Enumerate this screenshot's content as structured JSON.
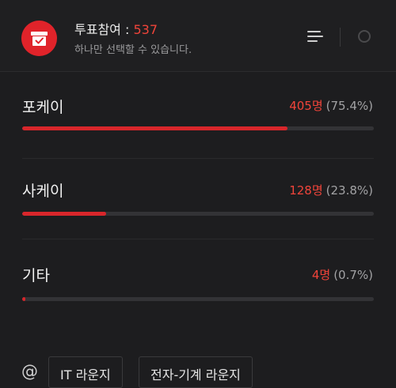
{
  "header": {
    "title_prefix": "투표참여 : ",
    "vote_count": "537",
    "subtitle": "하나만 선택할 수 있습니다."
  },
  "options": [
    {
      "label": "포케이",
      "votes": "405명",
      "percent": "(75.4%)",
      "share": 0.754
    },
    {
      "label": "사케이",
      "votes": "128명",
      "percent": "(23.8%)",
      "share": 0.238
    },
    {
      "label": "기타",
      "votes": "4명",
      "percent": "(0.7%)",
      "share": 0.007
    }
  ],
  "tags": {
    "at_symbol": "@",
    "items": [
      "IT 라운지",
      "전자-기계 라운지"
    ]
  },
  "icons": {
    "poll": "ballot-box-icon",
    "menu": "menu-lines-icon",
    "radio": "radio-circle-icon"
  },
  "colors": {
    "accent": "#e0232a",
    "count_text": "#f0443a",
    "bar_fill": "#d8262b",
    "bar_track": "#333336",
    "background": "#1d1d1f"
  }
}
